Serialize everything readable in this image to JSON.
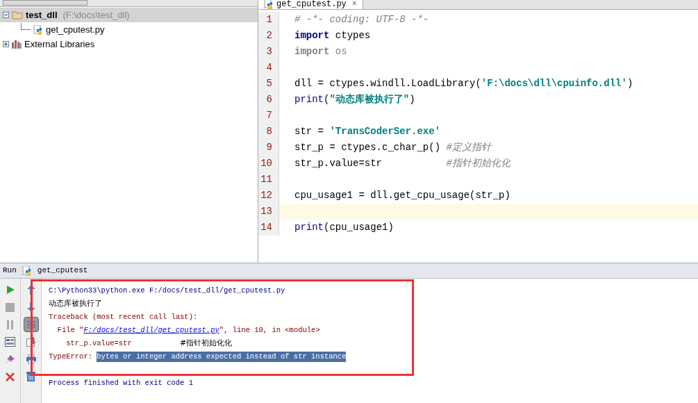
{
  "project_tree": [
    {
      "label": "test_dll",
      "path": "(F:\\docs\\test_dll)",
      "kind": "folder",
      "expanded": true,
      "selected": true,
      "children": [
        {
          "label": "get_cputest.py",
          "kind": "python",
          "selected": false
        }
      ]
    },
    {
      "label": "External Libraries",
      "kind": "library",
      "expanded": false,
      "selected": false
    }
  ],
  "editor": {
    "tab": {
      "label": "get_cputest.py",
      "close": "×"
    },
    "lines": [
      {
        "number": "1",
        "current": false,
        "tokens": [
          {
            "text": "# -*- coding: UTF-8 -*-",
            "kind": "comment"
          }
        ]
      },
      {
        "number": "2",
        "current": false,
        "tokens": [
          {
            "text": "import",
            "kind": "keyword"
          },
          {
            "text": " ctypes",
            "kind": "plain"
          }
        ]
      },
      {
        "number": "3",
        "current": false,
        "tokens": [
          {
            "text": "import",
            "kind": "unused_keyword"
          },
          {
            "text": " os",
            "kind": "unused"
          }
        ]
      },
      {
        "number": "4",
        "current": false
      },
      {
        "number": "5",
        "current": false,
        "tokens": [
          {
            "text": "dll = ctypes.windll.LoadLibrary(",
            "kind": "plain"
          },
          {
            "text": "'F:\\docs\\dll\\cpuinfo.dll'",
            "kind": "string"
          },
          {
            "text": ")",
            "kind": "plain"
          }
        ]
      },
      {
        "number": "6",
        "current": false,
        "tokens": [
          {
            "text": "print",
            "kind": "builtin"
          },
          {
            "text": "(",
            "kind": "plain"
          },
          {
            "text": "\"动态库被执行了\"",
            "kind": "string"
          },
          {
            "text": ")",
            "kind": "plain"
          }
        ]
      },
      {
        "number": "7",
        "current": false
      },
      {
        "number": "8",
        "current": false,
        "tokens": [
          {
            "text": "str = ",
            "kind": "plain"
          },
          {
            "text": "'TransCoderSer.exe'",
            "kind": "string"
          }
        ]
      },
      {
        "number": "9",
        "current": false,
        "tokens": [
          {
            "text": "str_p = ctypes.c_char_p() ",
            "kind": "plain"
          },
          {
            "text": "#定义指针",
            "kind": "comment"
          }
        ]
      },
      {
        "number": "10",
        "current": false,
        "tokens": [
          {
            "text": "str_p.value=str           ",
            "kind": "plain"
          },
          {
            "text": "#指针初始化化",
            "kind": "comment"
          }
        ]
      },
      {
        "number": "11",
        "current": false
      },
      {
        "number": "12",
        "current": false,
        "tokens": [
          {
            "text": "cpu_usage1 = dll.get_cpu_usage(str_p)",
            "kind": "plain"
          }
        ]
      },
      {
        "number": "13",
        "current": true
      },
      {
        "number": "14",
        "current": false,
        "tokens": [
          {
            "text": "print",
            "kind": "builtin"
          },
          {
            "text": "(cpu_usage1)",
            "kind": "plain"
          }
        ]
      }
    ]
  },
  "run_panel": {
    "label": "Run",
    "config": "get_cputest",
    "toolbar_left": [
      {
        "kind": "run",
        "selected": false
      },
      {
        "kind": "stop",
        "selected": false
      },
      {
        "kind": "pause",
        "selected": false
      },
      {
        "kind": "layout",
        "selected": false
      },
      {
        "kind": "pin",
        "selected": false
      },
      {
        "kind": "close",
        "selected": false
      }
    ],
    "toolbar_right": [
      {
        "kind": "up",
        "selected": false
      },
      {
        "kind": "down",
        "selected": false
      },
      {
        "kind": "wrap",
        "selected": true
      },
      {
        "kind": "export",
        "selected": false
      },
      {
        "kind": "print",
        "selected": false
      },
      {
        "kind": "trash",
        "selected": false
      }
    ],
    "console": [
      {
        "segments": [
          {
            "text": "C:\\Python33\\python.exe F:/docs/test_dll/get_cputest.py",
            "kind": "command"
          }
        ]
      },
      {
        "segments": [
          {
            "text": "动态库被执行了",
            "kind": "output"
          }
        ]
      },
      {
        "segments": [
          {
            "text": "Traceback (most recent call last):",
            "kind": "error"
          }
        ]
      },
      {
        "segments": [
          {
            "text": "  File \"",
            "kind": "error"
          },
          {
            "text": "F:/docs/test_dll/get_cputest.py",
            "kind": "link"
          },
          {
            "text": "\", line 10, in <module>",
            "kind": "error"
          }
        ]
      },
      {
        "segments": [
          {
            "text": "    str_p.value=str           ",
            "kind": "error"
          },
          {
            "text": "#指针初始化化",
            "kind": "output"
          }
        ]
      },
      {
        "segments": [
          {
            "text": "TypeError: ",
            "kind": "error"
          },
          {
            "text": "bytes or integer address expected instead of str instance",
            "kind": "selected"
          }
        ]
      },
      {
        "kind": "status",
        "segments": [
          {
            "text": "Process finished with exit code 1",
            "kind": "command"
          }
        ]
      }
    ]
  }
}
